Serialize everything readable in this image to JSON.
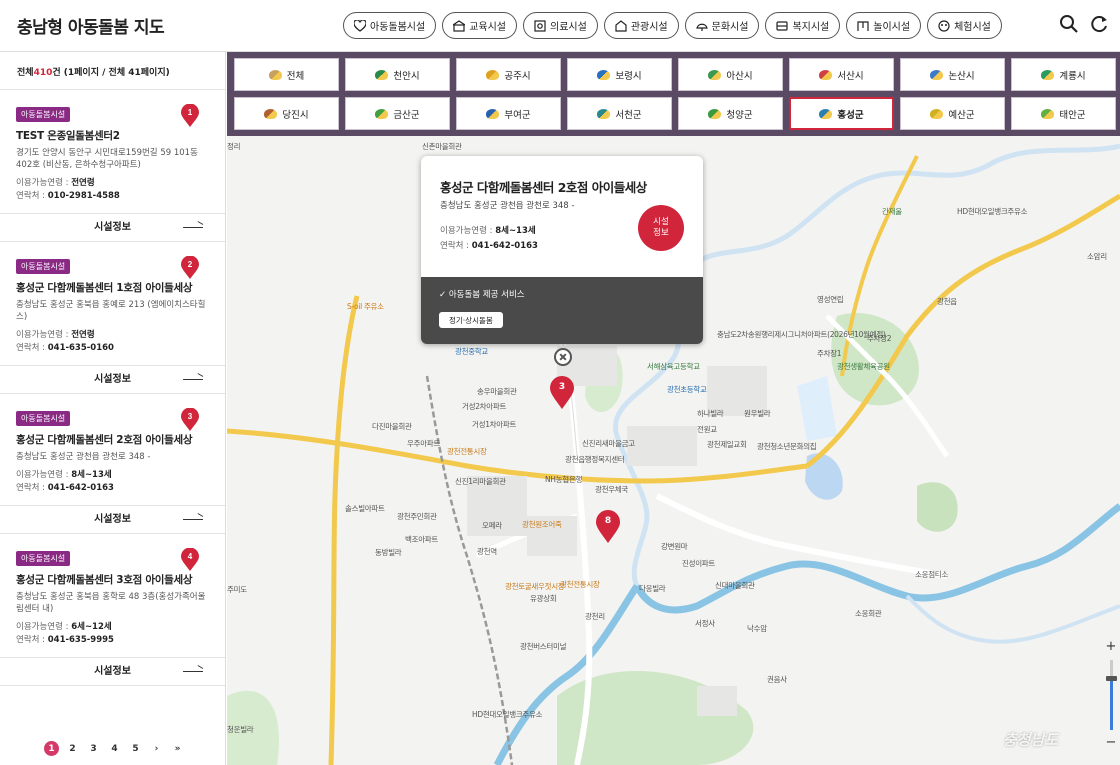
{
  "header": {
    "title": "충남형 아동돌봄 지도",
    "categories": [
      {
        "label": "아동돌봄시설",
        "icon": "heart-icon"
      },
      {
        "label": "교육시설",
        "icon": "school-icon"
      },
      {
        "label": "의료시설",
        "icon": "medical-icon"
      },
      {
        "label": "관광시설",
        "icon": "tourism-icon"
      },
      {
        "label": "문화시설",
        "icon": "culture-icon"
      },
      {
        "label": "복지시설",
        "icon": "welfare-icon"
      },
      {
        "label": "놀이시설",
        "icon": "playground-icon"
      },
      {
        "label": "체험시설",
        "icon": "experience-icon"
      }
    ]
  },
  "sidebar": {
    "summary_prefix": "전체",
    "summary_count": "410",
    "summary_suffix": "건 (1페이지 / 전체 41페이지)",
    "info_label": "시설정보",
    "cards": [
      {
        "num": "1",
        "badge": "아동돌봄시설",
        "title": "TEST 온종일돌봄센터2",
        "addr": "경기도 안양시 동안구 시민대로159번길 59 101동 402호 (비산동, 은하수청구아파트)",
        "age_label": "이용가능연령 : ",
        "age": "전연령",
        "phone_label": "연락처 : ",
        "phone": "010-2981-4588"
      },
      {
        "num": "2",
        "badge": "아동돌봄시설",
        "title": "홍성군 다함께돌봄센터 1호점 아이들세상",
        "addr": "충청남도 홍성군 홍북읍 홍예로 213 (엠에이치스타힐스)",
        "age_label": "이용가능연령 : ",
        "age": "전연령",
        "phone_label": "연락처 : ",
        "phone": "041-635-0160"
      },
      {
        "num": "3",
        "badge": "아동돌봄시설",
        "title": "홍성군 다함께돌봄센터 2호점 아이들세상",
        "addr": "충청남도 홍성군 광천읍 광천로 348 -",
        "age_label": "이용가능연령 : ",
        "age": "8세~13세",
        "phone_label": "연락처 : ",
        "phone": "041-642-0163"
      },
      {
        "num": "4",
        "badge": "아동돌봄시설",
        "title": "홍성군 다함께돌봄센터 3호점 아이들세상",
        "addr": "충청남도 홍성군 홍북읍 홍학로 48 3층(홍성가족어울림센터 내)",
        "age_label": "이용가능연령 : ",
        "age": "6세~12세",
        "phone_label": "연락처 : ",
        "phone": "041-635-9995"
      }
    ],
    "pagination": {
      "pages": [
        "1",
        "2",
        "3",
        "4",
        "5"
      ],
      "current": "1",
      "next": "›",
      "last": "»"
    }
  },
  "regions": [
    {
      "label": "전체",
      "color": "#c8a060"
    },
    {
      "label": "천안시",
      "color": "#2a8a4a"
    },
    {
      "label": "공주시",
      "color": "#e0a020"
    },
    {
      "label": "보령시",
      "color": "#2a70c0"
    },
    {
      "label": "아산시",
      "color": "#3a9a50"
    },
    {
      "label": "서산시",
      "color": "#d04040"
    },
    {
      "label": "논산시",
      "color": "#3a7ac8"
    },
    {
      "label": "계룡시",
      "color": "#2a9a60"
    },
    {
      "label": "당진시",
      "color": "#b06030"
    },
    {
      "label": "금산군",
      "color": "#40a040"
    },
    {
      "label": "부여군",
      "color": "#2a60b0"
    },
    {
      "label": "서천군",
      "color": "#2a8a8a"
    },
    {
      "label": "청양군",
      "color": "#3a9a40"
    },
    {
      "label": "홍성군",
      "color": "#2a80b0"
    },
    {
      "label": "예산군",
      "color": "#d0b020"
    },
    {
      "label": "태안군",
      "color": "#60b040"
    }
  ],
  "active_region": "홍성군",
  "popup": {
    "title": "홍성군 다함께돌봄센터 2호점 아이들세상",
    "addr": "충청남도 홍성군 광천읍 광천로 348 -",
    "age_label": "이용가능연령 : ",
    "age": "8세~13세",
    "phone_label": "연락처 : ",
    "phone": "041-642-0163",
    "info_button": "시설\n정보",
    "service": "✓ 아동돌봄 제공 서비스",
    "tag": "정기·상시돌봄"
  },
  "markers": [
    "3",
    "8"
  ],
  "map_labels": [
    "정리",
    "신촌마을회관",
    "간재울",
    "HD현대오일뱅크주유소",
    "소암리",
    "광천읍",
    "영성연립",
    "S-oil 주유소",
    "주차장1",
    "주차장2",
    "광천생활체육공원",
    "광천중학교",
    "서해삼육고등학교",
    "광천초등학교",
    "송우마을회관",
    "거성2차아파트",
    "거성1차아파트",
    "다진마을회관",
    "우주아파트",
    "광천전통시장",
    "하나빌라",
    "원우빌라",
    "전원교",
    "광천제일교회",
    "광천청소년문화의집",
    "신진리새마을금고",
    "광천읍행정복지센터",
    "NH농협은행",
    "광천우체국",
    "솔스빌아파트",
    "광천주민회관",
    "신진1리마을회관",
    "오페라",
    "광천원조어죽",
    "강변원마",
    "진성이파트",
    "백조아파트",
    "동방빌라",
    "광천역",
    "광천토굴새우젓시장",
    "광천전통시장",
    "유광상회",
    "다응빌라",
    "신대마을회관",
    "서정사",
    "낙수암",
    "소응회관",
    "소응점티소",
    "광천버스터미널",
    "광천리",
    "HD현대오일뱅크주유소",
    "권음사",
    "청운빌라",
    "주미도",
    "충남도2차송원행리제시그니처아파트(2026년10월예정)"
  ],
  "zoom": {
    "in": "+",
    "out": "−",
    "level": 0.75
  },
  "watermark": "충청남도"
}
